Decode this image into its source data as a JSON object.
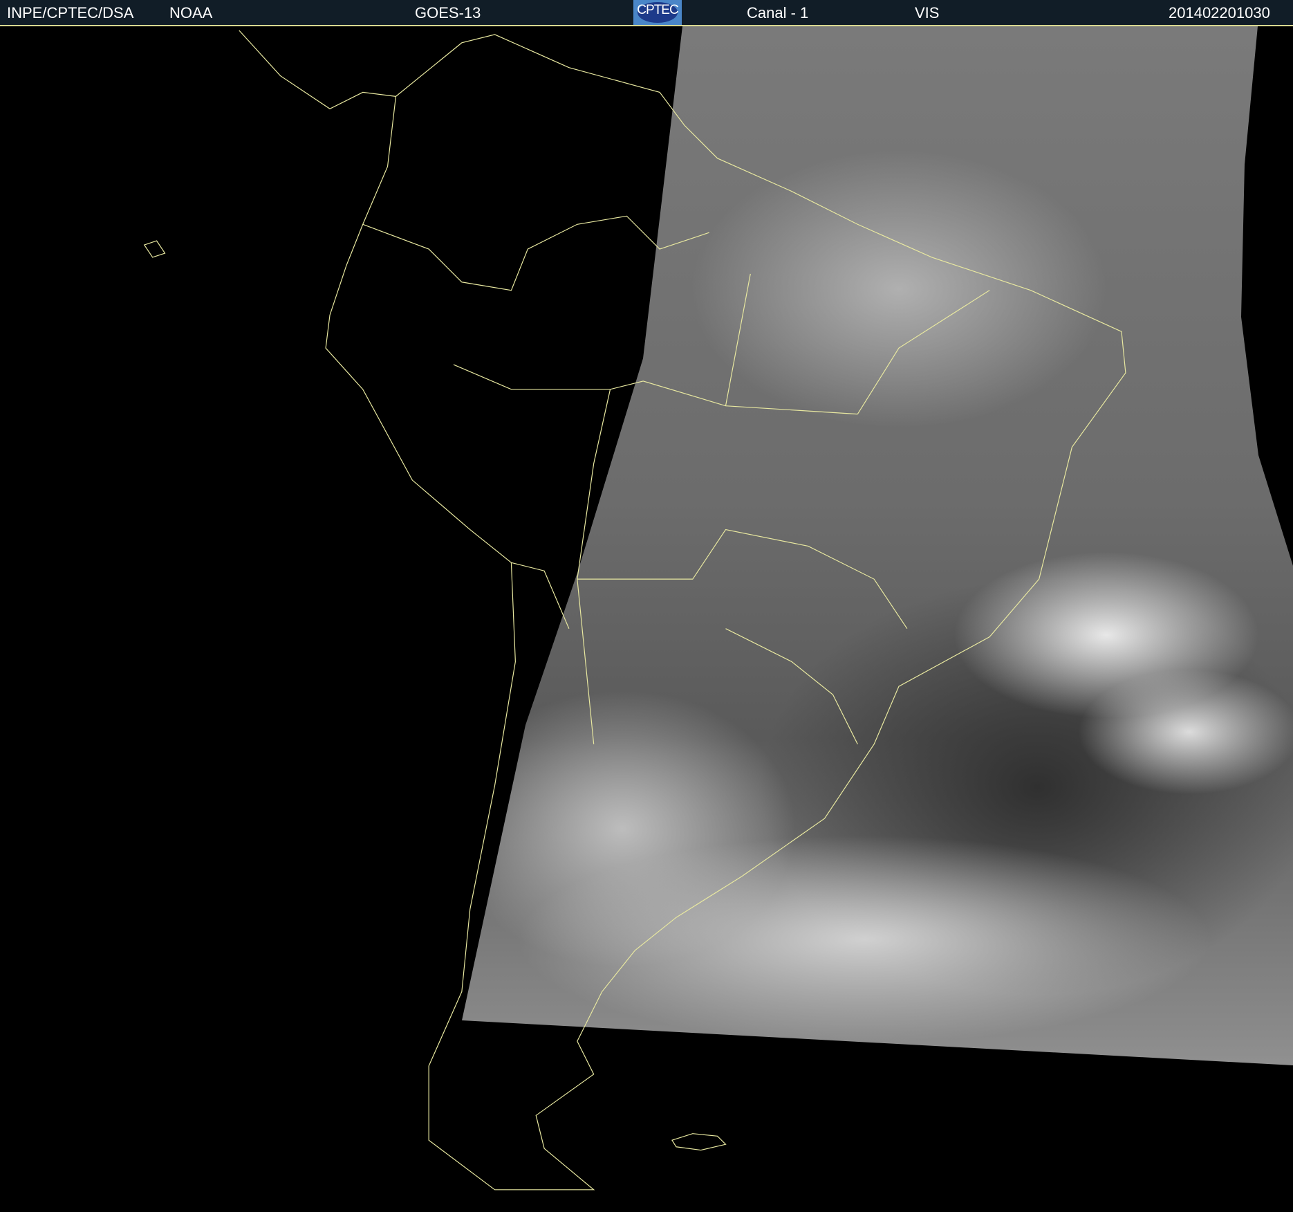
{
  "header": {
    "organization": "INPE/CPTEC/DSA",
    "agency": "NOAA",
    "satellite": "GOES-13",
    "logo_text": "CPTEC",
    "channel": "Canal - 1",
    "band": "VIS",
    "timestamp": "201402201030"
  },
  "colors": {
    "header_bg": "#111d27",
    "coastline": "#e8e8a0"
  }
}
